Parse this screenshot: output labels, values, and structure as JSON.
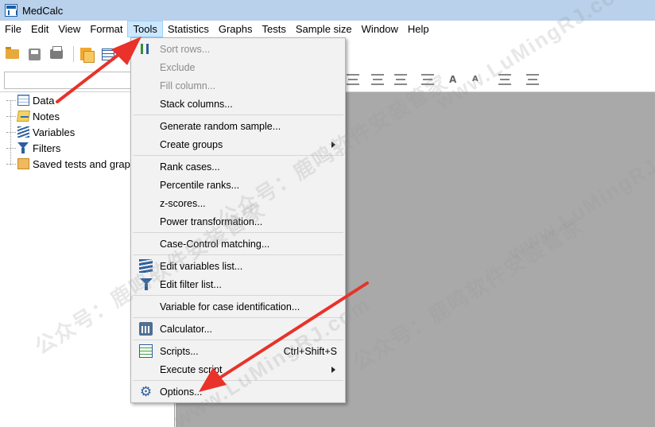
{
  "window": {
    "title": "MedCalc"
  },
  "menubar": {
    "items": [
      "File",
      "Edit",
      "View",
      "Format",
      "Tools",
      "Statistics",
      "Graphs",
      "Tests",
      "Sample size",
      "Window",
      "Help"
    ],
    "active": "Tools"
  },
  "sidebar": {
    "items": [
      {
        "label": "Data",
        "icon": "data-icon"
      },
      {
        "label": "Notes",
        "icon": "notes-icon"
      },
      {
        "label": "Variables",
        "icon": "variables-icon"
      },
      {
        "label": "Filters",
        "icon": "filter-icon"
      },
      {
        "label": "Saved tests and graphs",
        "icon": "saved-folder-icon"
      }
    ]
  },
  "tools_menu": {
    "items": [
      {
        "label": "Sort rows...",
        "disabled": true,
        "icon": "sort-icon"
      },
      {
        "label": "Exclude",
        "disabled": true
      },
      {
        "label": "Fill column...",
        "disabled": true
      },
      {
        "label": "Stack columns..."
      },
      {
        "label": "Generate random sample..."
      },
      {
        "label": "Create groups",
        "submenu": true
      },
      {
        "label": "Rank cases..."
      },
      {
        "label": "Percentile ranks..."
      },
      {
        "label": "z-scores..."
      },
      {
        "label": "Power transformation..."
      },
      {
        "label": "Case-Control matching..."
      },
      {
        "label": "Edit variables list...",
        "icon": "variables-icon"
      },
      {
        "label": "Edit filter list...",
        "icon": "filter-icon"
      },
      {
        "label": "Variable for case identification..."
      },
      {
        "label": "Calculator...",
        "icon": "calculator-icon"
      },
      {
        "label": "Scripts...",
        "shortcut": "Ctrl+Shift+S",
        "icon": "scripts-icon"
      },
      {
        "label": "Execute script",
        "submenu": true
      },
      {
        "label": "Options...",
        "icon": "gear-icon"
      }
    ]
  },
  "watermarks": [
    "www.LuMingRJ.com",
    "公众号：鹿鸣软件安装管家"
  ],
  "colors": {
    "titlebar": "#b9d1ea",
    "workspace": "#a9a9a9",
    "menu_bg": "#f2f2f2",
    "arrow": "#e8322a",
    "menu_highlight": "#cce8ff"
  }
}
